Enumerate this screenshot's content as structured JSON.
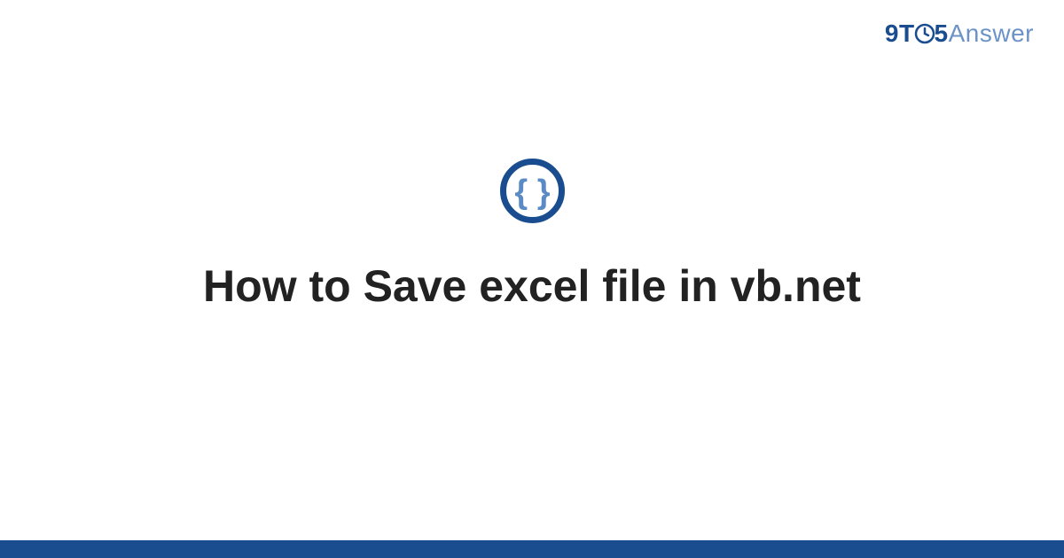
{
  "brand": {
    "part1": "9",
    "part2": "T",
    "part3": "5",
    "part4": "Answer"
  },
  "main": {
    "title": "How to Save excel file in vb.net"
  },
  "colors": {
    "primary": "#1a4d8f",
    "secondary": "#5a8bc4",
    "text": "#222222"
  }
}
